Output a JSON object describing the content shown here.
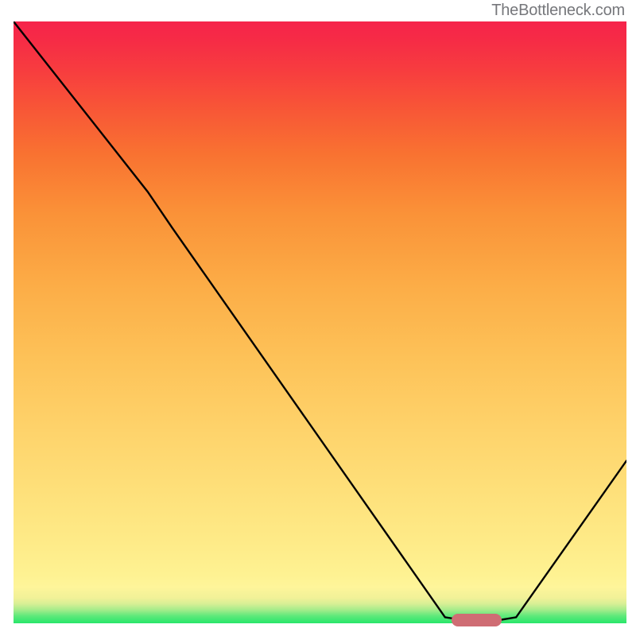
{
  "watermark": "TheBottleneck.com",
  "chart_data": {
    "type": "line",
    "title": "",
    "xlabel": "",
    "ylabel": "",
    "xlim": [
      0,
      100
    ],
    "ylim": [
      0,
      100
    ],
    "series": [
      {
        "name": "curve",
        "points": [
          {
            "x": 0.0,
            "y": 100.0
          },
          {
            "x": 21.9,
            "y": 71.7
          },
          {
            "x": 25.9,
            "y": 65.7
          },
          {
            "x": 70.4,
            "y": 1.0
          },
          {
            "x": 73.0,
            "y": 0.6
          },
          {
            "x": 79.4,
            "y": 0.55
          },
          {
            "x": 82.0,
            "y": 1.0
          },
          {
            "x": 100.0,
            "y": 27.0
          }
        ]
      }
    ],
    "marker": {
      "x_start": 71.5,
      "x_end": 79.7,
      "y": 0.55
    }
  }
}
